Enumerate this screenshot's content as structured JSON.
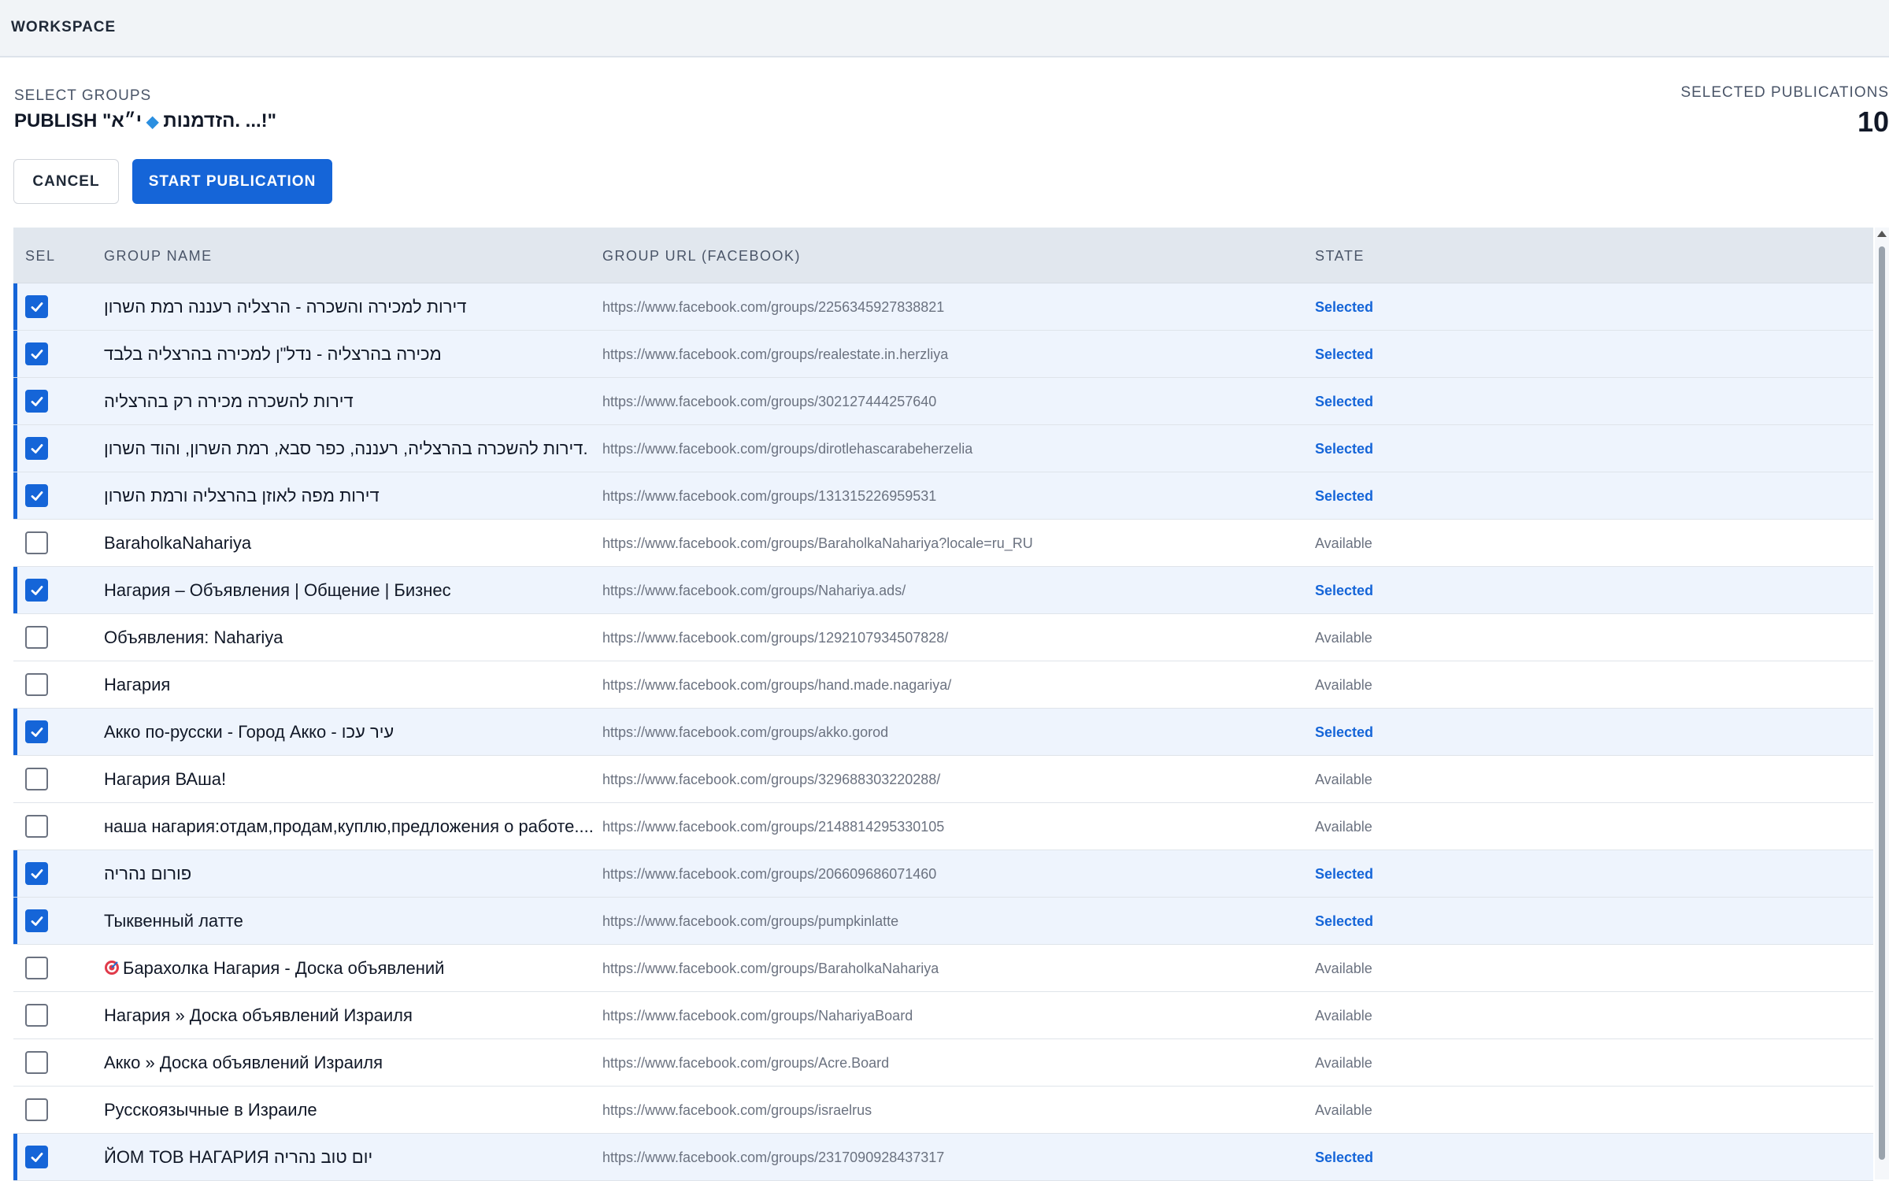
{
  "header": {
    "workspace_label": "WORKSPACE"
  },
  "select": {
    "label": "SELECT GROUPS",
    "publish_prefix": "PUBLISH \"הזדמנות",
    "publish_suffix": "י״א. ...!\""
  },
  "summary": {
    "label": "SELECTED PUBLICATIONS",
    "count": "10"
  },
  "actions": {
    "cancel": "CANCEL",
    "start": "START PUBLICATION"
  },
  "table": {
    "columns": {
      "sel": "SEL",
      "name": "GROUP NAME",
      "url": "GROUP URL (FACEBOOK)",
      "state": "STATE"
    },
    "rows": [
      {
        "selected": true,
        "name": "דירות למכירה והשכרה - הרצליה רעננה רמת השרון",
        "url": "https://www.facebook.com/groups/2256345927838821",
        "state": "Selected"
      },
      {
        "selected": true,
        "name": "מכירה בהרצליה - נדל\"ן למכירה בהרצליה בלבד",
        "url": "https://www.facebook.com/groups/realestate.in.herzliya",
        "state": "Selected"
      },
      {
        "selected": true,
        "name": "דירות להשכרה מכירה רק בהרצליה",
        "url": "https://www.facebook.com/groups/302127444257640",
        "state": "Selected"
      },
      {
        "selected": true,
        "name": "דירות להשכרה בהרצליה, רעננה, כפר סבא, רמת השרון, והוד השרון.",
        "url": "https://www.facebook.com/groups/dirotlehascarabeherzelia",
        "state": "Selected"
      },
      {
        "selected": true,
        "name": "דירות מפה לאוזן בהרצליה ורמת השרון",
        "url": "https://www.facebook.com/groups/131315226959531",
        "state": "Selected"
      },
      {
        "selected": false,
        "name": "BaraholkaNahariya",
        "url": "https://www.facebook.com/groups/BaraholkaNahariya?locale=ru_RU",
        "state": "Available"
      },
      {
        "selected": true,
        "name": "Нагария – Объявления | Общение | Бизнес",
        "url": "https://www.facebook.com/groups/Nahariya.ads/",
        "state": "Selected"
      },
      {
        "selected": false,
        "name": "Объявления: Nahariya",
        "url": "https://www.facebook.com/groups/1292107934507828/",
        "state": "Available"
      },
      {
        "selected": false,
        "name": "Нагария",
        "url": "https://www.facebook.com/groups/hand.made.nagariya/",
        "state": "Available"
      },
      {
        "selected": true,
        "name": "Акко по-русски - Город Акко - עיר עכו",
        "url": "https://www.facebook.com/groups/akko.gorod",
        "state": "Selected"
      },
      {
        "selected": false,
        "name": "Нагария ВАша!",
        "url": "https://www.facebook.com/groups/329688303220288/",
        "state": "Available"
      },
      {
        "selected": false,
        "name": "наша нагария:отдам,продам,куплю,предложения о работе....",
        "url": "https://www.facebook.com/groups/2148814295330105",
        "state": "Available"
      },
      {
        "selected": true,
        "name": "פורום נהריה",
        "url": "https://www.facebook.com/groups/206609686071460",
        "state": "Selected"
      },
      {
        "selected": true,
        "name": "Тыквенный латте",
        "url": "https://www.facebook.com/groups/pumpkinlatte",
        "state": "Selected"
      },
      {
        "selected": false,
        "name": "Барахолка Нагария - Доска объявлений",
        "icon": "target-icon",
        "url": "https://www.facebook.com/groups/BaraholkaNahariya",
        "state": "Available"
      },
      {
        "selected": false,
        "name": "Нагария » Доска объявлений Израиля",
        "url": "https://www.facebook.com/groups/NahariyaBoard",
        "state": "Available"
      },
      {
        "selected": false,
        "name": "Акко » Доска объявлений Израиля",
        "url": "https://www.facebook.com/groups/Acre.Board",
        "state": "Available"
      },
      {
        "selected": false,
        "name": "Русскоязычные в Израиле",
        "url": "https://www.facebook.com/groups/israelrus",
        "state": "Available"
      },
      {
        "selected": true,
        "name": "ЙОМ ТОВ НАГАРИЯ יום טוב נהריה",
        "url": "https://www.facebook.com/groups/2317090928437317",
        "state": "Selected"
      }
    ]
  },
  "colors": {
    "accent": "#1565d8",
    "selected_row_bg": "#eef4fd",
    "header_bg": "#e1e7ee"
  }
}
